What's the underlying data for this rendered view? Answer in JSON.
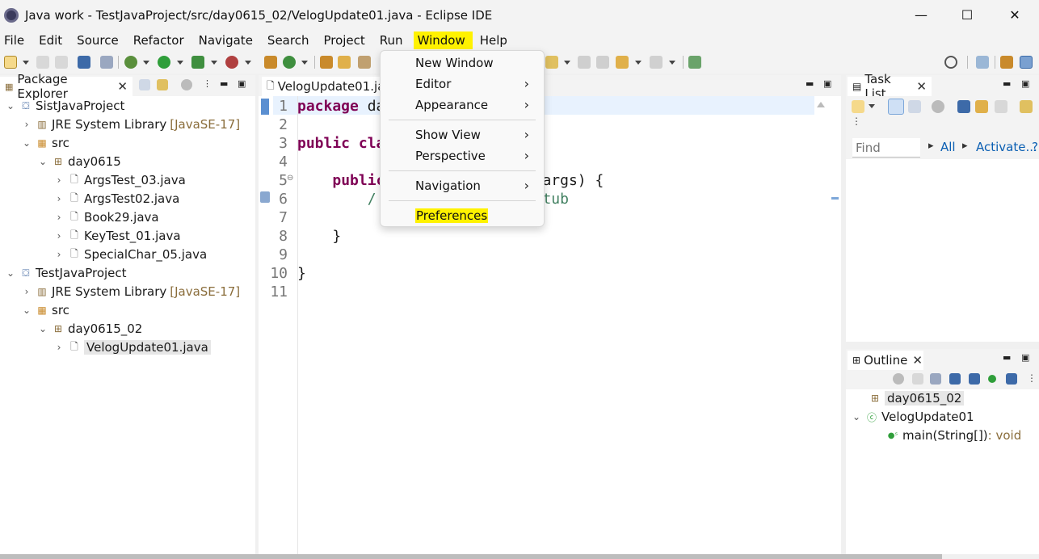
{
  "window": {
    "title": "Java work - TestJavaProject/src/day0615_02/VelogUpdate01.java - Eclipse IDE",
    "minimize": "—",
    "maximize": "☐",
    "close": "✕"
  },
  "menubar": {
    "items": [
      "File",
      "Edit",
      "Source",
      "Refactor",
      "Navigate",
      "Search",
      "Project",
      "Run",
      "Window",
      "Help"
    ],
    "active": "Window"
  },
  "window_menu": {
    "items": [
      {
        "label": "New Window",
        "submenu": false
      },
      {
        "label": "Editor",
        "submenu": true
      },
      {
        "label": "Appearance",
        "submenu": true
      },
      {
        "label": "Show View",
        "submenu": true
      },
      {
        "label": "Perspective",
        "submenu": true
      },
      {
        "label": "Navigation",
        "submenu": true
      },
      {
        "label": "Preferences",
        "submenu": false,
        "highlighted": true
      }
    ],
    "chevron": "›"
  },
  "package_explorer": {
    "title": "Package Explorer",
    "rows": [
      {
        "label": "SistJavaProject",
        "icon": "project-icon",
        "twisty": "⌄",
        "decor": ""
      },
      {
        "label": "JRE System Library",
        "icon": "library-icon",
        "twisty": "›",
        "decor": "[JavaSE-17]"
      },
      {
        "label": "src",
        "icon": "source-folder-icon",
        "twisty": "⌄",
        "decor": ""
      },
      {
        "label": "day0615",
        "icon": "package-icon",
        "twisty": "⌄",
        "decor": ""
      },
      {
        "label": "ArgsTest_03.java",
        "icon": "java-file-icon",
        "twisty": "›",
        "decor": ""
      },
      {
        "label": "ArgsTest02.java",
        "icon": "java-file-icon",
        "twisty": "›",
        "decor": ""
      },
      {
        "label": "Book29.java",
        "icon": "java-file-icon",
        "twisty": "›",
        "decor": ""
      },
      {
        "label": "KeyTest_01.java",
        "icon": "java-file-icon",
        "twisty": "›",
        "decor": ""
      },
      {
        "label": "SpecialChar_05.java",
        "icon": "java-file-icon",
        "twisty": "›",
        "decor": ""
      },
      {
        "label": "TestJavaProject",
        "icon": "project-icon",
        "twisty": "⌄",
        "decor": ""
      },
      {
        "label": "JRE System Library",
        "icon": "library-icon",
        "twisty": "›",
        "decor": "[JavaSE-17]"
      },
      {
        "label": "src",
        "icon": "source-folder-icon",
        "twisty": "⌄",
        "decor": ""
      },
      {
        "label": "day0615_02",
        "icon": "package-icon",
        "twisty": "⌄",
        "decor": ""
      },
      {
        "label": "VelogUpdate01.java",
        "icon": "java-file-icon",
        "twisty": "›",
        "decor": "",
        "selected": true
      }
    ]
  },
  "editor": {
    "tab_title": "VelogUpdate01.java",
    "lines": [
      {
        "n": "1",
        "parts": [
          {
            "t": "package",
            "c": "kw"
          },
          {
            "t": " da",
            "c": ""
          }
        ]
      },
      {
        "n": "2",
        "parts": []
      },
      {
        "n": "3",
        "parts": [
          {
            "t": "public",
            "c": "kw"
          },
          {
            "t": " ",
            "c": ""
          },
          {
            "t": "cla",
            "c": "kw"
          }
        ]
      },
      {
        "n": "4",
        "parts": []
      },
      {
        "n": "5",
        "parts": [
          {
            "t": "    ",
            "c": ""
          },
          {
            "t": "public",
            "c": "kw"
          },
          {
            "t": "         String[] args) {",
            "c": ""
          }
        ]
      },
      {
        "n": "6",
        "parts": [
          {
            "t": "        /",
            "c": "comment"
          },
          {
            "t": "        ed method stub",
            "c": "comment"
          }
        ]
      },
      {
        "n": "7",
        "parts": []
      },
      {
        "n": "8",
        "parts": [
          {
            "t": "    }",
            "c": ""
          }
        ]
      },
      {
        "n": "9",
        "parts": []
      },
      {
        "n": "10",
        "parts": [
          {
            "t": "}",
            "c": ""
          }
        ]
      },
      {
        "n": "11",
        "parts": []
      }
    ]
  },
  "task_list": {
    "title": "Task List",
    "find_placeholder": "Find",
    "all_label": "All",
    "activate_label": "Activate..."
  },
  "outline": {
    "title": "Outline",
    "package": "day0615_02",
    "class": "VelogUpdate01",
    "method": "main(String[])",
    "method_type": " : void"
  },
  "colors": {
    "highlight": "#fff200",
    "keyword": "#7f0055",
    "comment": "#3f7f5f",
    "link": "#0b5fb3"
  }
}
